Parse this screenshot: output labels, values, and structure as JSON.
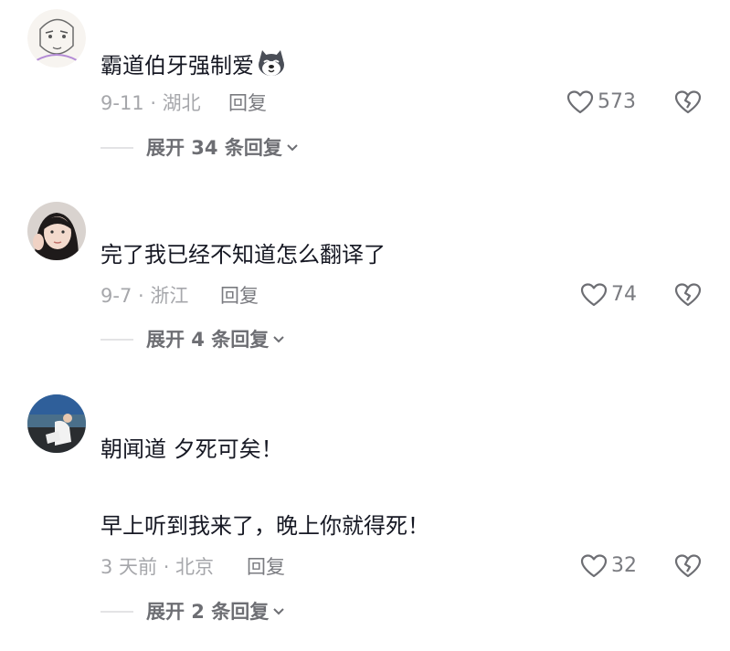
{
  "comments": [
    {
      "text": "霸道伯牙强制爱",
      "emoji_icon": "husky-dog-emoji",
      "meta": "9-11 · 湖北",
      "reply_label": "回复",
      "likes": "573",
      "expand_label": "展开 34 条回复"
    },
    {
      "text": "完了我已经不知道怎么翻译了",
      "meta": "9-7 · 浙江",
      "reply_label": "回复",
      "likes": "74",
      "expand_label": "展开 4 条回复"
    },
    {
      "text": "朝闻道 夕死可矣！",
      "text2": "早上听到我来了，晚上你就得死！",
      "meta": "3 天前 · 北京",
      "reply_label": "回复",
      "likes": "32",
      "expand_label": "展开 2 条回复"
    }
  ],
  "icons": {
    "like": "heart-outline-icon",
    "dislike": "broken-heart-icon",
    "expand": "chevron-down-icon"
  },
  "colors": {
    "text": "#161823",
    "meta": "#a6a7ab",
    "reply": "#7a7b80",
    "expand": "#6d6e73",
    "icon": "#6d6e73"
  }
}
